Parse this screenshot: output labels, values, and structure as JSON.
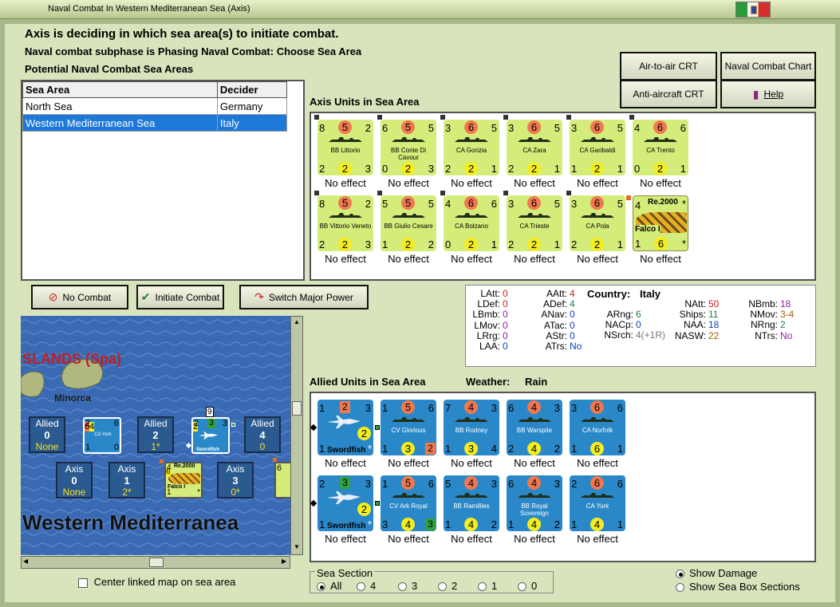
{
  "window": {
    "title": "Naval Combat In Western Mediterranean Sea (Axis)"
  },
  "header": {
    "line1": "Axis is deciding in which sea area(s) to initiate combat.",
    "line2": "Naval combat subphase is Phasing Naval Combat: Choose Sea Area",
    "line3": "Potential Naval Combat Sea Areas"
  },
  "buttons": {
    "air_to_air": "Air-to-air CRT",
    "naval_chart": "Naval Combat Chart",
    "anti_aircraft": "Anti-aircraft CRT",
    "help": "Help",
    "no_combat": "No Combat",
    "initiate": "Initiate Combat",
    "switch": "Switch Major Power"
  },
  "sea_table": {
    "headers": [
      "Sea Area",
      "Decider"
    ],
    "rows": [
      [
        "North Sea",
        "Germany"
      ],
      [
        "Western Mediterranean Sea",
        "Italy"
      ]
    ]
  },
  "axis_units": {
    "label": "Axis Units in Sea Area",
    "effect": "No effect",
    "counters": [
      {
        "tl": "8",
        "tc": "5",
        "tr": "2",
        "bl": "2",
        "bc": "2",
        "br": "3",
        "name": "BB Littorio"
      },
      {
        "tl": "6",
        "tc": "5",
        "tr": "5",
        "bl": "0",
        "bc": "2",
        "br": "3",
        "name": "BB Conte Di Cavour"
      },
      {
        "tl": "3",
        "tc": "6",
        "tr": "5",
        "bl": "2",
        "bc": "2",
        "br": "1",
        "name": "CA Gorizia"
      },
      {
        "tl": "3",
        "tc": "6",
        "tr": "5",
        "bl": "2",
        "bc": "2",
        "br": "1",
        "name": "CA Zara"
      },
      {
        "tl": "3",
        "tc": "6",
        "tr": "5",
        "bl": "1",
        "bc": "2",
        "br": "1",
        "name": "CA Garibaldi"
      },
      {
        "tl": "4",
        "tc": "6",
        "tr": "6",
        "bl": "0",
        "bc": "2",
        "br": "1",
        "name": "CA Trento"
      },
      {
        "tl": "8",
        "tc": "5",
        "tr": "2",
        "bl": "2",
        "bc": "2",
        "br": "3",
        "name": "BB Vittorio Veneto"
      },
      {
        "tl": "5",
        "tc": "5",
        "tr": "5",
        "bl": "1",
        "bc": "2",
        "br": "2",
        "name": "BB Giulio Cesare"
      },
      {
        "tl": "4",
        "tc": "6",
        "tr": "6",
        "bl": "0",
        "bc": "2",
        "br": "1",
        "name": "CA Bolzano"
      },
      {
        "tl": "3",
        "tc": "6",
        "tr": "5",
        "bl": "2",
        "bc": "2",
        "br": "1",
        "name": "CA Trieste"
      },
      {
        "tl": "3",
        "tc": "6",
        "tr": "5",
        "bl": "2",
        "bc": "2",
        "br": "1",
        "name": "CA Pola"
      }
    ],
    "plane": {
      "top": "Re.2000",
      "tl": "4",
      "bl": "1",
      "bc": "6",
      "name": "Falco I",
      "star": "*"
    }
  },
  "stats": {
    "col1": [
      [
        "LAtt:",
        "0"
      ],
      [
        "LDef:",
        "0"
      ],
      [
        "LBmb:",
        "0"
      ],
      [
        "LMov:",
        "0"
      ],
      [
        "LRrg:",
        "0"
      ],
      [
        "LAA:",
        "0"
      ]
    ],
    "col2": [
      [
        "AAtt:",
        "4"
      ],
      [
        "ADef:",
        "4"
      ],
      [
        "ANav:",
        "0"
      ],
      [
        "ATac:",
        "0"
      ],
      [
        "AStr:",
        "0"
      ],
      [
        "ATrs:",
        "No"
      ]
    ],
    "country_label": "Country:",
    "country": "Italy",
    "col3": [
      [
        "ARng:",
        "6"
      ],
      [
        "NACp:",
        "0"
      ],
      [
        "NSrch:",
        "4(+1R)"
      ]
    ],
    "col4": [
      [
        "NAtt:",
        "50"
      ],
      [
        "Ships:",
        "11"
      ],
      [
        "NAA:",
        "18"
      ],
      [
        "NASW:",
        "22"
      ]
    ],
    "col5": [
      [
        "NBmb:",
        "18"
      ],
      [
        "NMov:",
        "3-4"
      ],
      [
        "NRng:",
        "2"
      ],
      [
        "NTrs:",
        "No"
      ]
    ]
  },
  "allied_units": {
    "label": "Allied Units in Sea Area",
    "weather_label": "Weather:",
    "weather": "Rain",
    "effect": "No effect",
    "plane1": {
      "tl": "1",
      "tc": "2",
      "tr": "3",
      "bc": "2",
      "bl": "1",
      "name": "Swordfish",
      "star": "*"
    },
    "plane2": {
      "tl": "2",
      "tc": "3",
      "tr": "3",
      "bc": "2",
      "bl": "1",
      "name": "Swordfish",
      "star": "*"
    },
    "counters": [
      {
        "tl": "1",
        "tc": "5",
        "tr": "6",
        "bl": "1",
        "bc": "3",
        "br": "2",
        "name": "CV Glorious"
      },
      {
        "tl": "7",
        "tc": "4",
        "tr": "3",
        "bl": "1",
        "bc": "3",
        "br": "4",
        "name": "BB Rodney"
      },
      {
        "tl": "6",
        "tc": "4",
        "tr": "3",
        "bl": "2",
        "bc": "4",
        "br": "2",
        "name": "BB Warspite"
      },
      {
        "tl": "3",
        "tc": "6",
        "tr": "6",
        "bl": "1",
        "bc": "6",
        "br": "1",
        "name": "CA Norfolk"
      },
      {
        "tl": "1",
        "tc": "5",
        "tr": "6",
        "bl": "3",
        "bc": "4",
        "br": "3",
        "name": "CV Ark Royal"
      },
      {
        "tl": "5",
        "tc": "4",
        "tr": "3",
        "bl": "1",
        "bc": "4",
        "br": "2",
        "name": "BB Ramillies"
      },
      {
        "tl": "6",
        "tc": "4",
        "tr": "3",
        "bl": "1",
        "bc": "4",
        "br": "2",
        "name": "BB Royal Sovereign"
      },
      {
        "tl": "2",
        "tc": "6",
        "tr": "6",
        "bl": "1",
        "bc": "4",
        "br": "1",
        "name": "CA York"
      }
    ]
  },
  "map": {
    "islands_label": "SLANDS (Spa)",
    "minorca": "Minorca",
    "sea_name": "Western Mediterranea",
    "allied_boxes": [
      {
        "l": "Allied",
        "n": "0",
        "s": "None"
      },
      {
        "l": "Allied",
        "n": "2",
        "s": "1*"
      },
      {
        "l": "Allied",
        "n": "4",
        "s": "0"
      }
    ],
    "axis_boxes": [
      {
        "l": "Axis",
        "n": "0",
        "s": "None"
      },
      {
        "l": "Axis",
        "n": "1",
        "s": "2*"
      },
      {
        "l": "Axis",
        "n": "3",
        "s": "0*"
      }
    ],
    "mini_york": {
      "tl": "2",
      "tc": "6",
      "tr": "6",
      "bl": "1",
      "bc": "4",
      "br": "0",
      "name": "CA York"
    },
    "mini_swordfish": {
      "badge": "9",
      "tl": "2",
      "tc": "3",
      "tr": "3",
      "bc": "2",
      "name": "Swordfish"
    },
    "mini_re": {
      "top": "Re.2000",
      "tl": "4",
      "bl": "1",
      "bc": "6",
      "name": "Falco I",
      "star": "*"
    },
    "mini_partial": "6"
  },
  "bottom": {
    "center_map": "Center linked map on sea area",
    "sea_section": "Sea Section",
    "sections": [
      "All",
      "4",
      "3",
      "2",
      "1",
      "0"
    ],
    "show_damage": "Show Damage",
    "show_boxes": "Show Sea Box Sections"
  }
}
